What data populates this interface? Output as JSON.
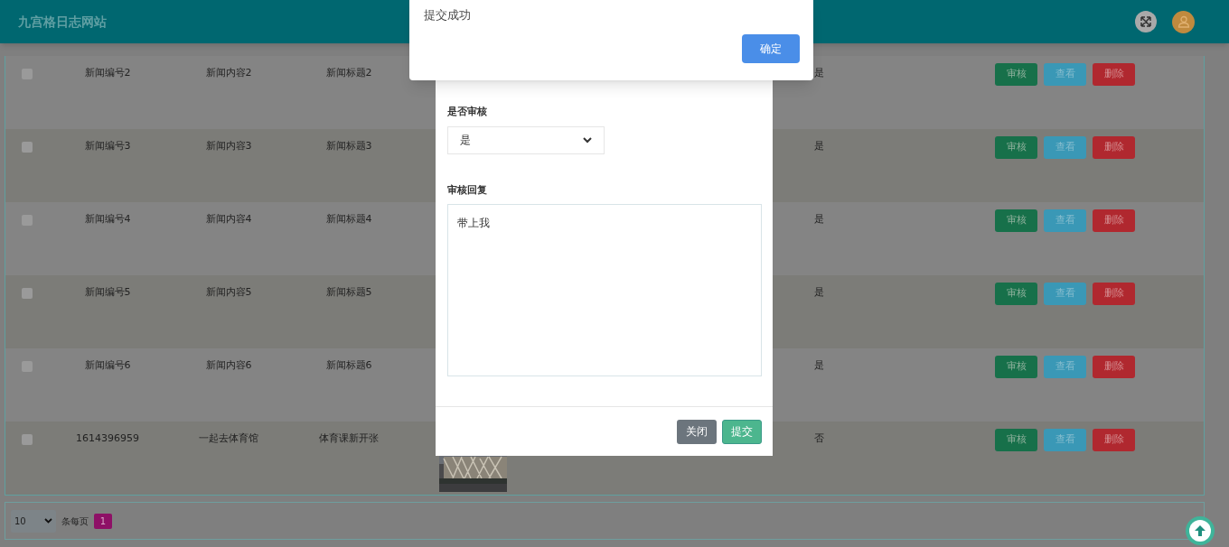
{
  "header": {
    "title": "九宫格日志网站"
  },
  "table": {
    "rows": [
      {
        "checked": false,
        "id": "新闻编号2",
        "content": "新闻内容2",
        "title": "新闻标题2",
        "reviewed": "是",
        "actions": [
          {
            "kind": "review",
            "label": "审核"
          },
          {
            "kind": "view",
            "label": "查看"
          },
          {
            "kind": "delete",
            "label": "删除"
          }
        ]
      },
      {
        "checked": false,
        "id": "新闻编号3",
        "content": "新闻内容3",
        "title": "新闻标题3",
        "reviewed": "是",
        "actions": [
          {
            "kind": "review",
            "label": "审核"
          },
          {
            "kind": "view",
            "label": "查看"
          },
          {
            "kind": "delete",
            "label": "删除"
          }
        ]
      },
      {
        "checked": false,
        "id": "新闻编号4",
        "content": "新闻内容4",
        "title": "新闻标题4",
        "reviewed": "是",
        "actions": [
          {
            "kind": "review",
            "label": "审核"
          },
          {
            "kind": "view",
            "label": "查看"
          },
          {
            "kind": "delete",
            "label": "删除"
          }
        ]
      },
      {
        "checked": false,
        "id": "新闻编号5",
        "content": "新闻内容5",
        "title": "新闻标题5",
        "reviewed": "是",
        "actions": [
          {
            "kind": "review",
            "label": "审核"
          },
          {
            "kind": "view",
            "label": "查看"
          },
          {
            "kind": "delete",
            "label": "删除"
          }
        ]
      },
      {
        "checked": false,
        "id": "新闻编号6",
        "content": "新闻内容6",
        "title": "新闻标题6",
        "reviewed": "是",
        "actions": [
          {
            "kind": "review",
            "label": "审核"
          },
          {
            "kind": "view",
            "label": "查看"
          },
          {
            "kind": "delete",
            "label": "删除"
          }
        ]
      },
      {
        "checked": false,
        "id": "1614396959",
        "content": "一起去体育馆",
        "title": "体育课新开张",
        "reviewed": "否",
        "actions": [
          {
            "kind": "review",
            "label": "审核"
          },
          {
            "kind": "view",
            "label": "查看"
          },
          {
            "kind": "delete",
            "label": "删除"
          }
        ]
      }
    ]
  },
  "pagination": {
    "page_size": "10",
    "page_size_label": "条每页",
    "pages": [
      {
        "label": "1",
        "selected": true
      }
    ]
  },
  "modal": {
    "fields": [
      {
        "kind": "select",
        "label": "是否审核",
        "value": "是"
      },
      {
        "kind": "textarea",
        "label": "审核回复",
        "value": "带上我"
      }
    ],
    "buttons": [
      {
        "kind": "secondary",
        "label": "关闭"
      },
      {
        "kind": "primary",
        "label": "提交"
      }
    ]
  },
  "alert": {
    "message": "提交成功",
    "button": "确定"
  }
}
